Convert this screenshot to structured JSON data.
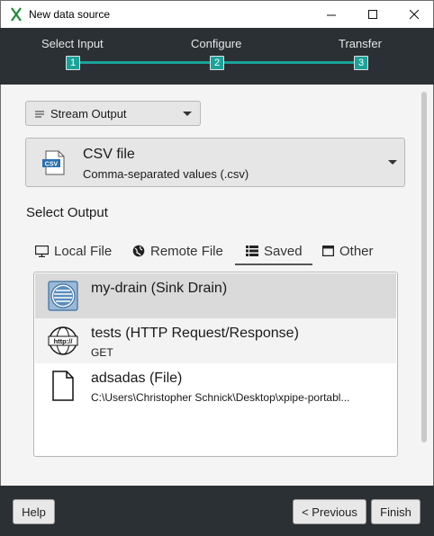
{
  "window": {
    "title": "New data source"
  },
  "stepper": {
    "steps": [
      {
        "label": "Select Input",
        "number": "1"
      },
      {
        "label": "Configure",
        "number": "2"
      },
      {
        "label": "Transfer",
        "number": "3"
      }
    ],
    "accent": "#1aa39a"
  },
  "stream_select": {
    "label": "Stream Output",
    "icon": "list-lines-icon"
  },
  "format_select": {
    "title": "CSV file",
    "description": "Comma-separated values (.csv)",
    "icon_text": "CSV"
  },
  "section": {
    "heading": "Select Output"
  },
  "tabs": [
    {
      "label": "Local File",
      "icon": "monitor-icon"
    },
    {
      "label": "Remote File",
      "icon": "globe-icon"
    },
    {
      "label": "Saved",
      "icon": "list-icon",
      "selected": true
    },
    {
      "label": "Other",
      "icon": "window-icon"
    }
  ],
  "saved_list": [
    {
      "title": "my-drain (Sink Drain)",
      "subtitle": "",
      "icon": "drain-icon"
    },
    {
      "title": "tests (HTTP Request/Response)",
      "subtitle": "GET",
      "icon": "http-icon",
      "icon_text": "http://"
    },
    {
      "title": "adsadas (File)",
      "subtitle": "C:\\Users\\Christopher Schnick\\Desktop\\xpipe-portabl...",
      "icon": "file-icon"
    }
  ],
  "footer": {
    "help": "Help",
    "previous": "< Previous",
    "finish": "Finish"
  }
}
